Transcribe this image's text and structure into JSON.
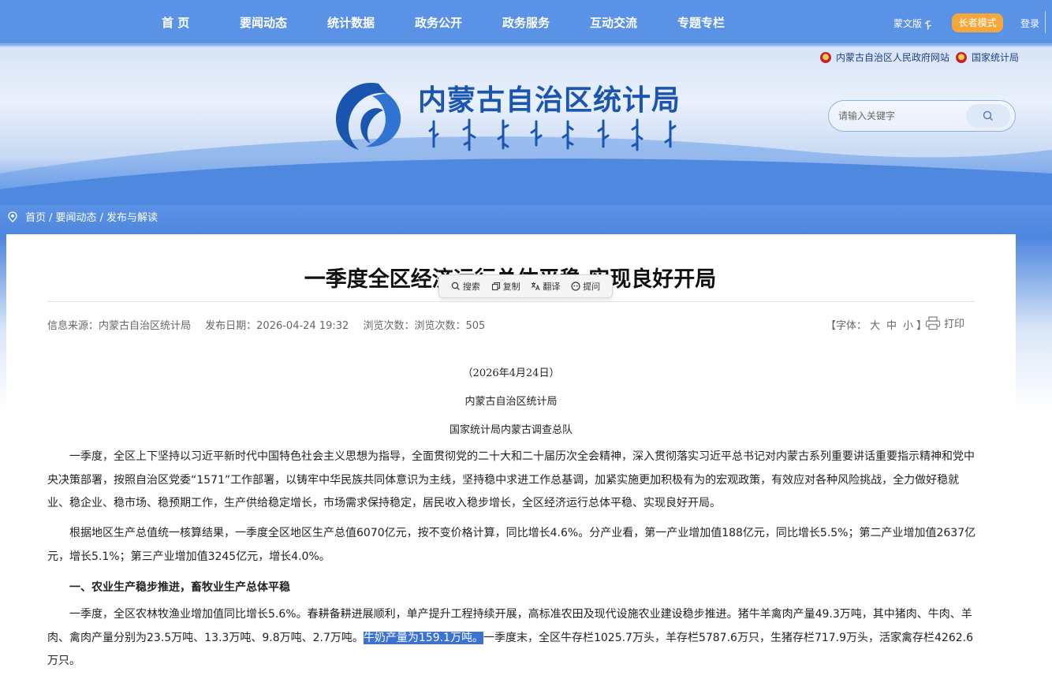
{
  "nav": {
    "items": [
      "首 页",
      "要闻动态",
      "统计数据",
      "政务公开",
      "政务服务",
      "互动交流",
      "专题专栏"
    ],
    "mongol_version": "蒙文版",
    "elder_mode": "长者模式",
    "login": "登录"
  },
  "ext_links": [
    "内蒙古自治区人民政府网站",
    "国家统计局"
  ],
  "site": {
    "title": "内蒙古自治区统计局"
  },
  "search": {
    "placeholder": "请输入关键字"
  },
  "breadcrumb": [
    "首页",
    "要闻动态",
    "发布与解读"
  ],
  "article": {
    "title": "一季度全区经济运行总体平稳  实现良好开局",
    "source": "信息来源：内蒙古自治区统计局",
    "date": "发布日期：2026-04-24 19:32",
    "views": "浏览次数：浏览次数：505",
    "font_label": "【字体：",
    "font_large": "大",
    "font_medium": "中",
    "font_small": "小",
    "font_close": "】",
    "print": "打印",
    "date_line": "（2026年4月24日）",
    "org1": "内蒙古自治区统计局",
    "org2": "国家统计局内蒙古调查总队",
    "p1": "一季度，全区上下坚持以习近平新时代中国特色社会主义思想为指导，全面贯彻党的二十大和二十届历次全会精神，深入贯彻落实习近平总书记对内蒙古系列重要讲话重要指示精神和党中央决策部署，按照自治区党委“1571”工作部署，以铸牢中华民族共同体意识为主线，坚持稳中求进工作总基调，加紧实施更加积极有为的宏观政策，有效应对各种风险挑战，全力做好稳就业、稳企业、稳市场、稳预期工作，生产供给稳定增长，市场需求保持稳定，居民收入稳步增长，全区经济运行总体平稳、实现良好开局。",
    "p2": "根据地区生产总值统一核算结果，一季度全区地区生产总值6070亿元，按不变价格计算，同比增长4.6%。分产业看，第一产业增加值188亿元，同比增长5.5%；第二产业增加值2637亿元，增长5.1%；第三产业增加值3245亿元，增长4.0%。",
    "section1": "一、农业生产稳步推进，畜牧业生产总体平稳",
    "p3_before": "一季度，全区农林牧渔业增加值同比增长5.6%。春耕备耕进展顺利，单产提升工程持续开展，高标准农田及现代设施农业建设稳步推进。猪牛羊禽肉产量49.3万吨，其中猪肉、牛肉、羊肉、禽肉产量分别为23.5万吨、13.3万吨、9.8万吨、2.7万吨。",
    "p3_highlight": "牛奶产量为159.1万吨。",
    "p3_after": "一季度末，全区牛存栏1025.7万头，羊存栏5787.6万只，生猪存栏717.9万头，活家禽存栏4262.6万只。"
  },
  "popover": {
    "search": "搜索",
    "copy": "复制",
    "translate": "翻译",
    "ask": "提问"
  },
  "colors": {
    "nav_bg": "#5a92e6",
    "accent_orange": "#f4a83b",
    "title_blue": "#1a56b0",
    "highlight": "#3a73d3"
  }
}
